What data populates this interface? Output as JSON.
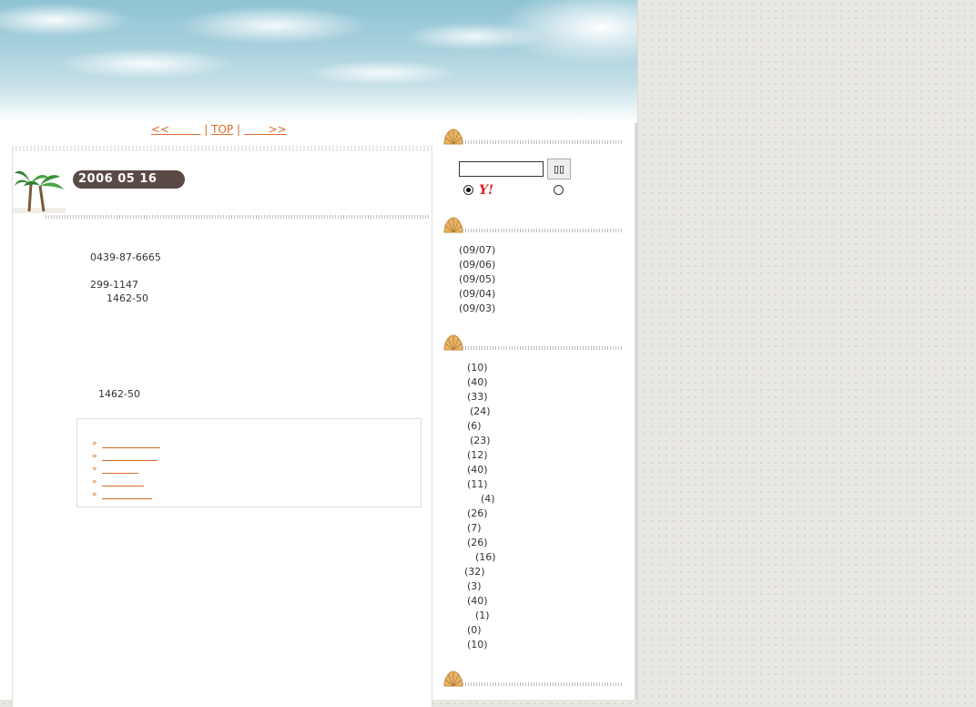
{
  "nav": {
    "prev": "<<",
    "top": "TOP",
    "next": ">>",
    "sep": "|"
  },
  "entry": {
    "date": "2006  05  16",
    "phone": "0439-87-6665",
    "postal": "299-1147",
    "address1": "1462-50",
    "address2": "1462-50",
    "related_links": [
      "",
      "",
      "",
      "",
      ""
    ]
  },
  "sidebar": {
    "search": {
      "input_value": "",
      "button_label": "▯▯",
      "yahoo_label": "Y!"
    },
    "recent_dates": [
      "(09/07)",
      "(09/06)",
      "(09/05)",
      "(09/04)",
      "(09/03)"
    ],
    "category_counts": [
      "(10)",
      "(40)",
      "(33)",
      "(24)",
      "(6)",
      "(23)",
      "(12)",
      "(40)",
      "(11)",
      "(4)",
      "(26)",
      "(7)",
      "(26)",
      "(16)",
      "(32)",
      "(3)",
      "(40)",
      "(1)",
      "(0)",
      "(10)"
    ]
  },
  "colors": {
    "link": "#d86b2c",
    "badge": "#5a4a46",
    "yahoo": "#e0202a"
  }
}
